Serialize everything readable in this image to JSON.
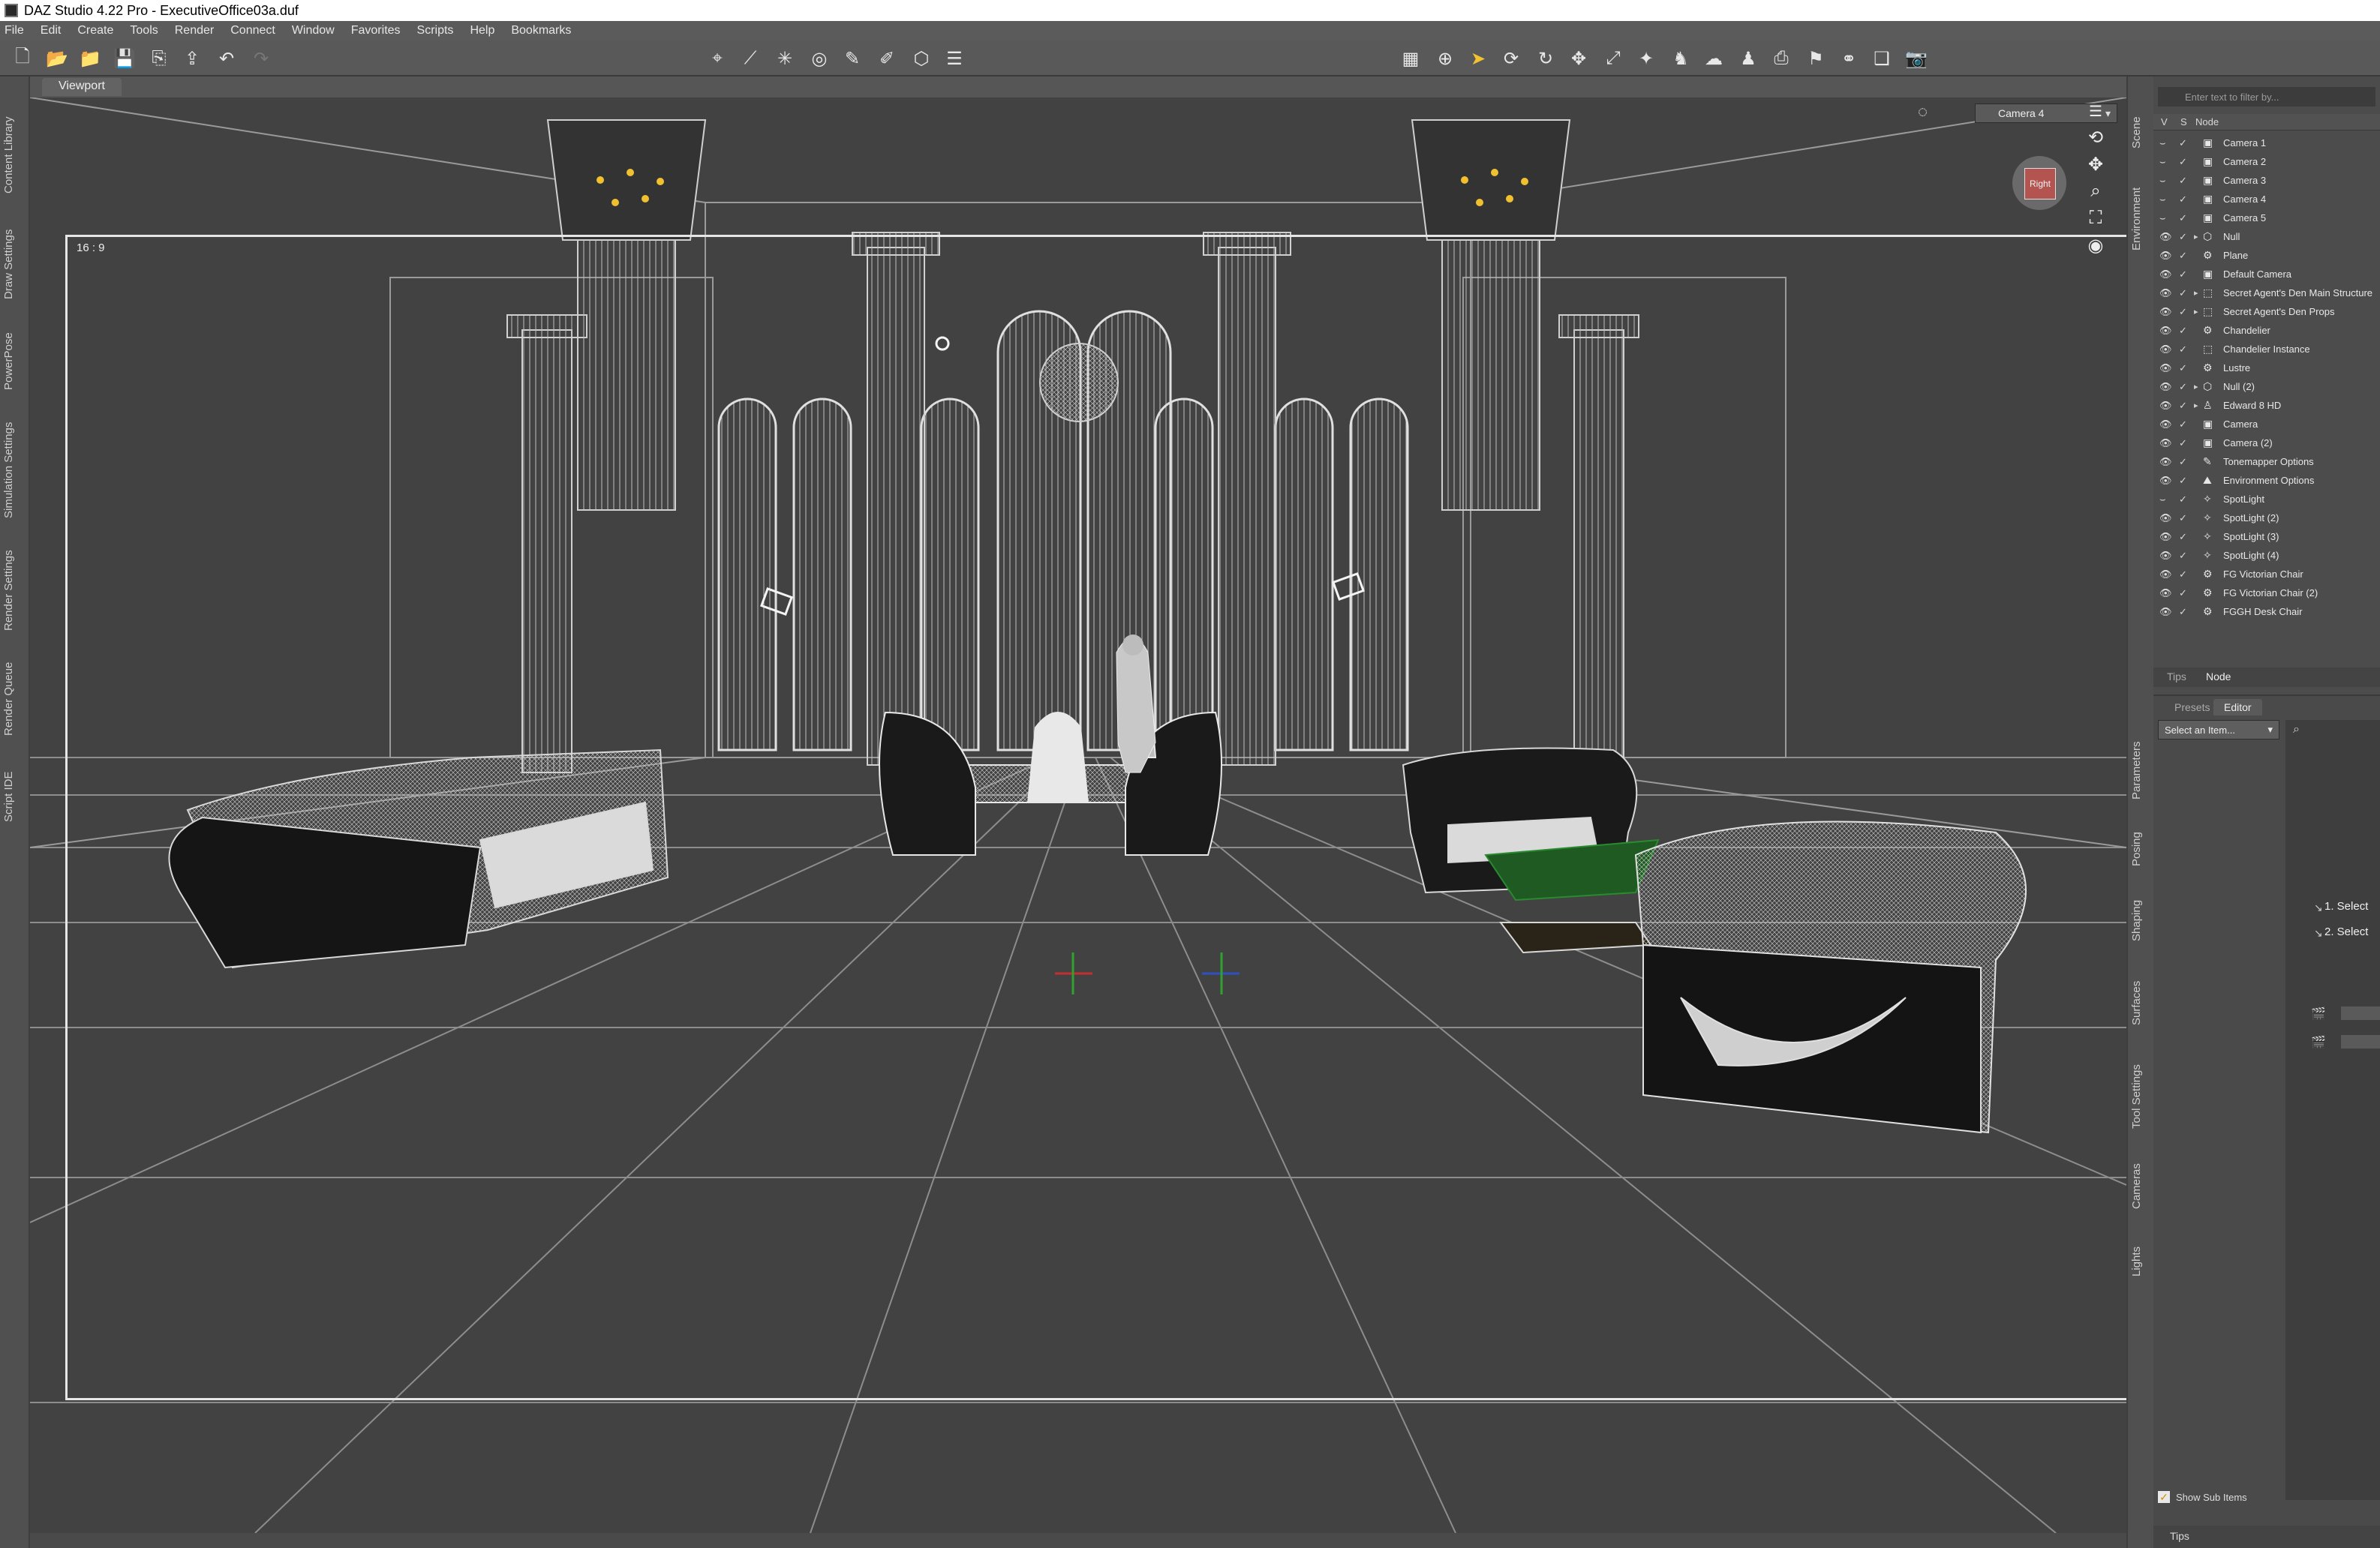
{
  "window": {
    "title": "DAZ Studio 4.22 Pro - ExecutiveOffice03a.duf"
  },
  "menu": [
    "File",
    "Edit",
    "Create",
    "Tools",
    "Render",
    "Connect",
    "Window",
    "Favorites",
    "Scripts",
    "Help",
    "Bookmarks"
  ],
  "left_tabs": [
    "Content Library",
    "Draw Settings",
    "PowerPose",
    "Simulation Settings",
    "Render Settings",
    "Render Queue",
    "Script IDE"
  ],
  "viewport": {
    "tab": "Viewport",
    "aspect": "16 : 9",
    "camera": "Camera 4",
    "cube_face": "Right"
  },
  "right_tabs": [
    "Scene",
    "Environment",
    "Parameters",
    "Posing",
    "Shaping",
    "Surfaces",
    "Tool Settings",
    "Cameras",
    "Lights"
  ],
  "scene": {
    "filter_placeholder": "Enter text to filter by...",
    "col_v": "V",
    "col_s": "S",
    "col_node": "Node",
    "nodes": [
      "Camera 1",
      "Camera 2",
      "Camera 3",
      "Camera 4",
      "Camera 5",
      "Null",
      "Plane",
      "Default Camera",
      "Secret Agent's Den Main Structure",
      "Secret Agent's Den Props",
      "Chandelier",
      "Chandelier Instance",
      "Lustre",
      "Null (2)",
      "Edward 8 HD",
      "Camera",
      "Camera (2)",
      "Tonemapper Options",
      "Environment Options",
      "SpotLight",
      "SpotLight (2)",
      "SpotLight (3)",
      "SpotLight (4)",
      "FG Victorian Chair",
      "FG Victorian Chair (2)",
      "FGGH Desk Chair"
    ]
  },
  "scene_tabs": {
    "tips": "Tips",
    "node": "Node"
  },
  "params": {
    "presets_tab": "Presets",
    "editor_tab": "Editor",
    "select_item": "Select an Item...",
    "step1": "1. Select",
    "step2": "2. Select",
    "show_sub_items": "Show Sub Items",
    "tips": "Tips"
  }
}
